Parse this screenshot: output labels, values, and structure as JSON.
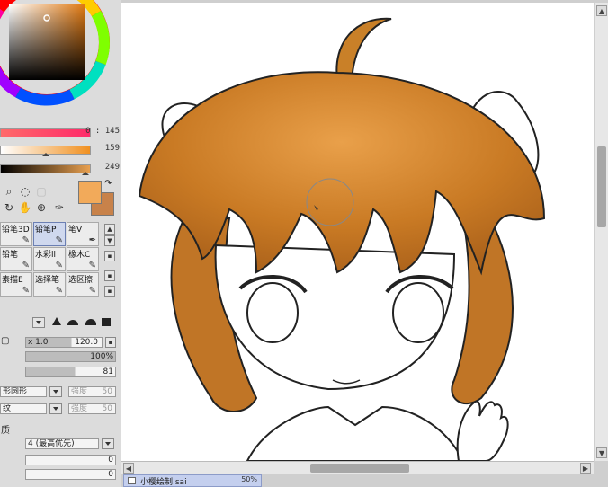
{
  "color_panel": {
    "slider_hue_value": "0 : 145",
    "slider_sat_value": "159",
    "slider_val_value": "249",
    "fg_color": "#f2aa5a",
    "bg_color": "#c8824a"
  },
  "tools": {
    "icons": [
      "magnify-icon",
      "lasso-icon",
      "hand-icon",
      "rotate-icon",
      "eyedropper-icon",
      "swap-colors-icon"
    ]
  },
  "brushes": [
    {
      "label": "铅笔3D",
      "glyph": "✎"
    },
    {
      "label": "铅笔P",
      "glyph": "✎"
    },
    {
      "label": "笔V",
      "glyph": "✒"
    },
    {
      "label": "铅笔",
      "glyph": "✎"
    },
    {
      "label": "水彩ll",
      "glyph": "✎"
    },
    {
      "label": "橡木C",
      "glyph": "✎"
    },
    {
      "label": "素描E",
      "glyph": "✎"
    },
    {
      "label": "选择笔",
      "glyph": "✎"
    },
    {
      "label": "选区擦",
      "glyph": "✎"
    }
  ],
  "brush_props": {
    "size_range": "x 1.0",
    "size_max": "120.0",
    "density": "100%",
    "min_size": "81",
    "shape_label": "形圆形",
    "blend_value": "强度",
    "blend_num": "50",
    "texture_label": "纹",
    "texture_value": "强度",
    "texture_num": "50",
    "quality_label": "质",
    "quality_value": "4 (最高优先)",
    "edge_value_1": "0",
    "edge_value_2": "0"
  },
  "document": {
    "tab_label": "小樱绘制.sai",
    "zoom": "50%"
  }
}
